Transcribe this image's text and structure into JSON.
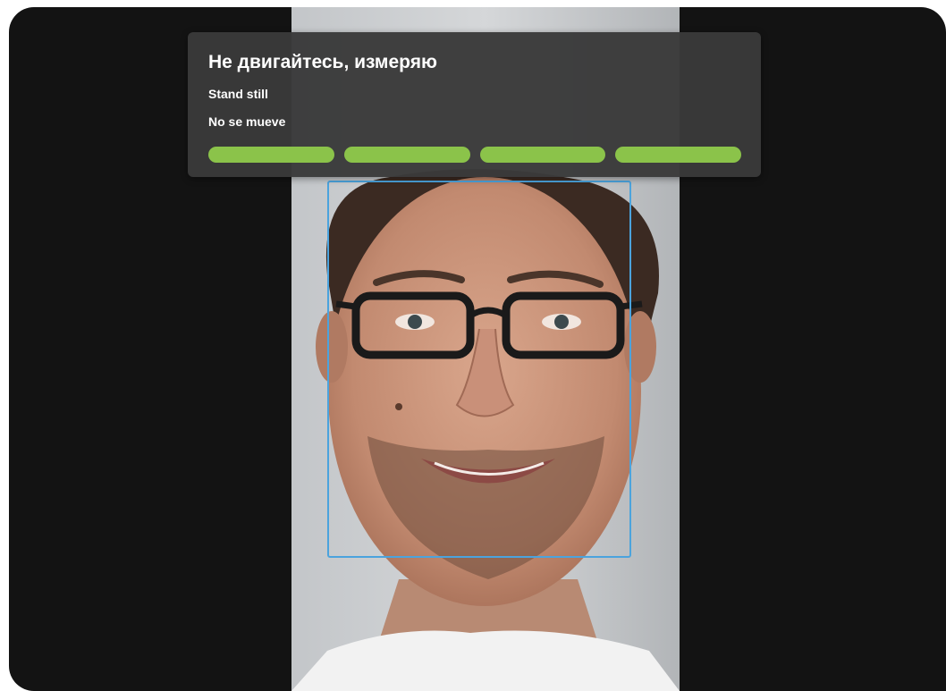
{
  "status": {
    "title": "Не двигайтесь, измеряю",
    "line_en": "Stand still",
    "line_es": "No se mueve",
    "progress": {
      "segments": 4,
      "completed": 4,
      "fraction": 1.0,
      "color_filled": "#8bc34a"
    }
  },
  "face_box": {
    "color": "#4ba3dd"
  },
  "frame": {
    "background": "#131313"
  }
}
